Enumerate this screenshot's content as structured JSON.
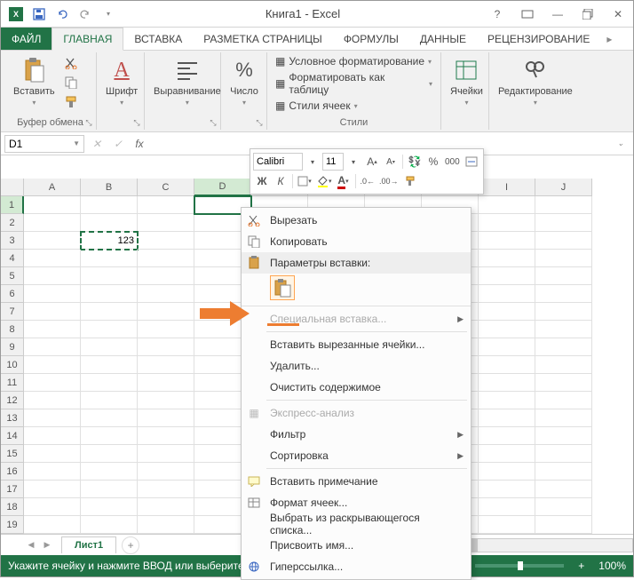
{
  "app": {
    "title": "Книга1 - Excel"
  },
  "tabs": {
    "file": "ФАЙЛ",
    "items": [
      "ГЛАВНАЯ",
      "ВСТАВКА",
      "РАЗМЕТКА СТРАНИЦЫ",
      "ФОРМУЛЫ",
      "ДАННЫЕ",
      "РЕЦЕНЗИРОВАНИЕ"
    ],
    "active": 0
  },
  "ribbon": {
    "clipboard": {
      "paste": "Вставить",
      "label": "Буфер обмена"
    },
    "font": {
      "label": "Шрифт"
    },
    "align": {
      "label": "Выравнивание"
    },
    "number": {
      "label": "Число"
    },
    "styles": {
      "cond": "Условное форматирование",
      "table": "Форматировать как таблицу",
      "cell": "Стили ячеек",
      "label": "Стили"
    },
    "cells": {
      "label": "Ячейки"
    },
    "editing": {
      "label": "Редактирование"
    }
  },
  "namebox": "D1",
  "mini": {
    "font": "Calibri",
    "size": "11"
  },
  "columns": [
    "A",
    "B",
    "C",
    "D",
    "E",
    "F",
    "G",
    "H",
    "I",
    "J"
  ],
  "rows": 19,
  "selected": {
    "col": 3,
    "row": 0
  },
  "copied": {
    "col": 1,
    "row": 2,
    "value": "123"
  },
  "ctx": {
    "cut": "Вырезать",
    "copy": "Копировать",
    "paste_opts": "Параметры вставки:",
    "paste_special": "Специальная вставка...",
    "insert_cut": "Вставить вырезанные ячейки...",
    "delete": "Удалить...",
    "clear": "Очистить содержимое",
    "quick": "Экспресс-анализ",
    "filter": "Фильтр",
    "sort": "Сортировка",
    "comment": "Вставить примечание",
    "format": "Формат ячеек...",
    "dropdown": "Выбрать из раскрывающегося списка...",
    "name": "Присвоить имя...",
    "hyperlink": "Гиперссылка..."
  },
  "sheet": {
    "name": "Лист1"
  },
  "status": {
    "msg": "Укажите ячейку и нажмите ВВОД или выберите \"Вставить\"",
    "zoom": "100%"
  }
}
